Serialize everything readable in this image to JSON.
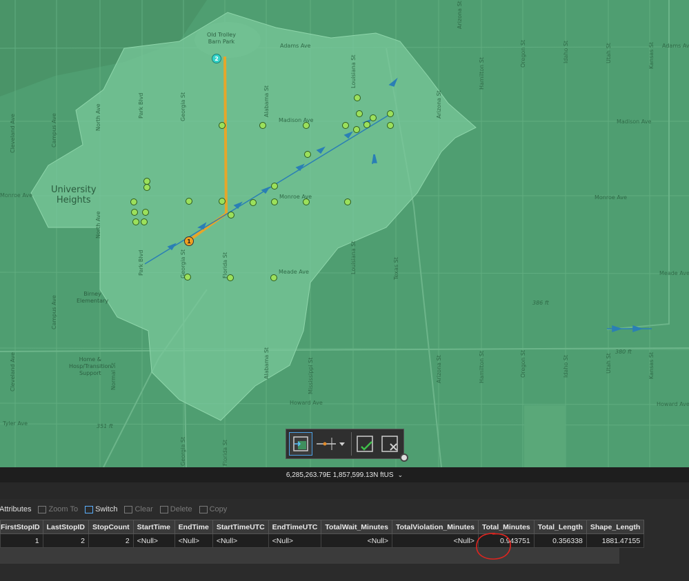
{
  "map": {
    "place_labels": {
      "park": "Old Trolley\nBarn Park",
      "university_heights": "University\nHeights",
      "birney": "Birney\nElementary",
      "home_hosp": "Home &\nHosp/Transition\nSupport"
    },
    "street_labels": {
      "adams_ave_1": "Adams Ave",
      "adams_ave_2": "Adams Ave",
      "madison_ave_1": "Madison Ave",
      "madison_ave_2": "Madison Ave",
      "monroe_ave_1": "Monroe Ave",
      "monroe_ave_2": "Monroe Ave",
      "monroe_ave_3": "Monroe Ave",
      "meade_ave_1": "Meade Ave",
      "meade_ave_2": "Meade Ave",
      "howard_ave_1": "Howard Ave",
      "howard_ave_2": "Howard Ave",
      "tyler_ave": "Tyler Ave",
      "cleveland_ave_1": "Cleveland Ave",
      "cleveland_ave_2": "Cleveland Ave",
      "campus_ave_1": "Campus Ave",
      "campus_ave_2": "Campus Ave",
      "north_ave_1": "North Ave",
      "north_ave_2": "North Ave",
      "park_blvd_1": "Park Blvd",
      "park_blvd_2": "Park Blvd",
      "georgia_st_1": "Georgia St",
      "georgia_st_2": "Georgia St",
      "georgia_st_3": "Georgia St",
      "florida_st_1": "Florida St",
      "florida_st_2": "Florida St",
      "alabama_st_1": "Alabama St",
      "alabama_st_2": "Alabama St",
      "mississippi_st": "Mississippi St",
      "louisiana_st_1": "Louisiana St",
      "louisiana_st_2": "Louisiana St",
      "texas_st": "Texas St",
      "arizona_st_1": "Arizona St",
      "arizona_st_2": "Arizona St",
      "arizona_st_3": "Arizona St",
      "hamilton_st_1": "Hamilton St",
      "hamilton_st_2": "Hamilton St",
      "oregon_st_1": "Oregon St",
      "oregon_st_2": "Oregon St",
      "idaho_st_1": "Idaho St",
      "idaho_st_2": "Idaho St",
      "utah_st_1": "Utah St",
      "utah_st_2": "Utah St",
      "kansas_st_1": "Kansas St",
      "kansas_st_2": "Kansas St",
      "normal_st": "Normal St"
    },
    "elevation_labels": {
      "e386": "386 ft",
      "e380": "380 ft",
      "e351": "351 ft"
    },
    "stops": {
      "start": "1",
      "end": "2"
    },
    "colors": {
      "base": "#4f9e71",
      "service_area": "#7ac99b",
      "route": "#e6a62a",
      "start_marker": "#f0a020",
      "end_marker": "#34d3c8",
      "stop_fill": "#9be05c",
      "arrow": "#2a7fb5"
    }
  },
  "edit_toolbar": {
    "tools": [
      "select-features-icon",
      "split-line-icon",
      "dropdown-chevron-icon",
      "finish-sketch-icon",
      "cancel-sketch-icon"
    ]
  },
  "status": {
    "coordinates": "6,285,263.79E 1,857,599.13N ftUS"
  },
  "table_toolbar": {
    "attributes": "Attributes",
    "zoom_to": "Zoom To",
    "switch": "Switch",
    "clear": "Clear",
    "delete": "Delete",
    "copy": "Copy"
  },
  "table": {
    "columns": [
      "FirstStopID",
      "LastStopID",
      "StopCount",
      "StartTime",
      "EndTime",
      "StartTimeUTC",
      "EndTimeUTC",
      "TotalWait_Minutes",
      "TotalViolation_Minutes",
      "Total_Minutes",
      "Total_Length",
      "Shape_Length"
    ],
    "rows": [
      [
        "1",
        "2",
        "2",
        "<Null>",
        "<Null>",
        "<Null>",
        "<Null>",
        "<Null>",
        "<Null>",
        "0.943751",
        "0.356338",
        "1881.47155"
      ]
    ],
    "annotation_color": "#e0241f"
  }
}
